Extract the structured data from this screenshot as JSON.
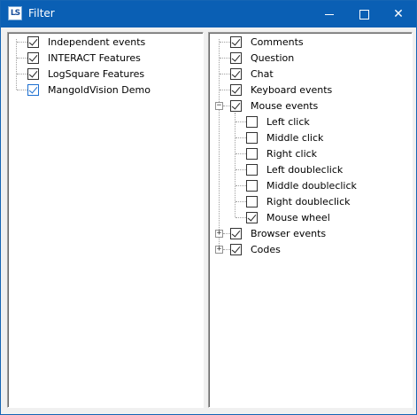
{
  "window": {
    "title": "Filter",
    "icon": "LS"
  },
  "left_tree": [
    {
      "label": "Independent events",
      "checked": true
    },
    {
      "label": "INTERACT Features",
      "checked": true
    },
    {
      "label": "LogSquare Features",
      "checked": true
    },
    {
      "label": "MangoldVision Demo",
      "checked": true,
      "focused": true
    }
  ],
  "right_tree": {
    "comments": {
      "label": "Comments",
      "checked": true
    },
    "question": {
      "label": "Question",
      "checked": true
    },
    "chat": {
      "label": "Chat",
      "checked": true
    },
    "keyboard": {
      "label": "Keyboard events",
      "checked": true
    },
    "mouse": {
      "label": "Mouse events",
      "checked": true,
      "expanded": true,
      "children": [
        {
          "label": "Left click",
          "checked": false
        },
        {
          "label": "Middle click",
          "checked": false
        },
        {
          "label": "Right click",
          "checked": false
        },
        {
          "label": "Left doubleclick",
          "checked": false
        },
        {
          "label": "Middle doubleclick",
          "checked": false
        },
        {
          "label": "Right doubleclick",
          "checked": false
        },
        {
          "label": "Mouse wheel",
          "checked": true
        }
      ]
    },
    "browser": {
      "label": "Browser events",
      "checked": true,
      "expanded": false
    },
    "codes": {
      "label": "Codes",
      "checked": true,
      "expanded": false
    }
  },
  "glyphs": {
    "collapse": "−",
    "expand": "+",
    "close": "✕"
  }
}
